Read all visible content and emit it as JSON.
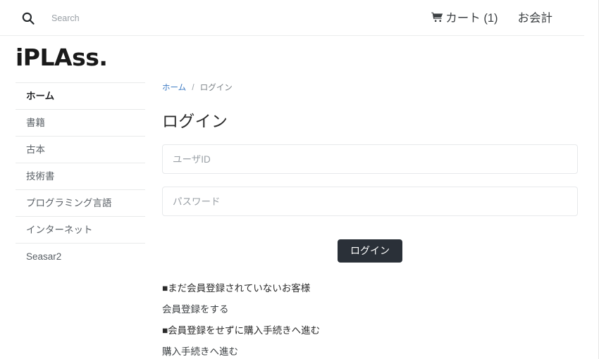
{
  "header": {
    "search": {
      "icon": "search-icon",
      "placeholder": "Search",
      "value": ""
    },
    "cart": {
      "icon": "shopping-cart-icon",
      "label": "カート (1)",
      "count": 1
    },
    "checkout": {
      "label": "お会計"
    }
  },
  "brand": {
    "name": "iPLAss."
  },
  "sidebar": {
    "items": [
      {
        "label": "ホーム",
        "active": true
      },
      {
        "label": "書籍",
        "active": false
      },
      {
        "label": "古本",
        "active": false
      },
      {
        "label": "技術書",
        "active": false
      },
      {
        "label": "プログラミング言語",
        "active": false
      },
      {
        "label": "インターネット",
        "active": false
      },
      {
        "label": "Seasar2",
        "active": false
      }
    ]
  },
  "breadcrumb": {
    "home": "ホーム",
    "separator": "/",
    "current": "ログイン"
  },
  "main": {
    "title": "ログイン",
    "user_id_field": {
      "placeholder": "ユーザID",
      "value": ""
    },
    "password_field": {
      "placeholder": "パスワード",
      "value": ""
    },
    "login_button": "ログイン",
    "links": [
      {
        "text": "■まだ会員登録されていないお客様",
        "is_heading": true
      },
      {
        "text": "会員登録をする",
        "is_heading": false
      },
      {
        "text": "■会員登録をせずに購入手続きへ進む",
        "is_heading": true
      },
      {
        "text": "購入手続きへ進む",
        "is_heading": false
      }
    ]
  },
  "colors": {
    "button_dark": "#2a3038",
    "link_blue": "#3e7bc4",
    "muted_text": "#9aa0a6",
    "border": "#e9eaea"
  }
}
